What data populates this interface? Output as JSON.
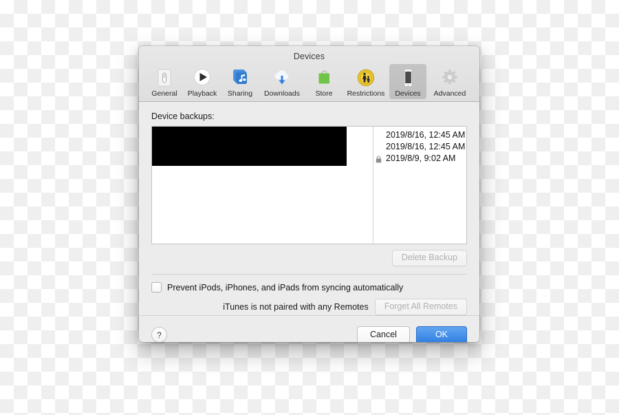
{
  "window": {
    "title": "Devices"
  },
  "toolbar": {
    "tabs": [
      {
        "label": "General",
        "icon": "general-icon",
        "selected": false
      },
      {
        "label": "Playback",
        "icon": "playback-icon",
        "selected": false
      },
      {
        "label": "Sharing",
        "icon": "sharing-icon",
        "selected": false
      },
      {
        "label": "Downloads",
        "icon": "downloads-icon",
        "selected": false
      },
      {
        "label": "Store",
        "icon": "store-icon",
        "selected": false
      },
      {
        "label": "Restrictions",
        "icon": "restrictions-icon",
        "selected": false
      },
      {
        "label": "Devices",
        "icon": "devices-icon",
        "selected": true
      },
      {
        "label": "Advanced",
        "icon": "advanced-icon",
        "selected": false
      }
    ]
  },
  "main": {
    "backups_label": "Device backups:",
    "backup_rows": [
      {
        "name": "",
        "date": "2019/8/16, 12:45 AM",
        "locked": false
      },
      {
        "name": "",
        "date": "2019/8/16, 12:45 AM",
        "locked": false
      },
      {
        "name": "",
        "date": "2019/8/9, 9:02 AM",
        "locked": true
      }
    ],
    "delete_backup_label": "Delete Backup",
    "delete_backup_enabled": false,
    "prevent_sync_label": "Prevent iPods, iPhones, and iPads from syncing automatically",
    "prevent_sync_checked": false,
    "remotes_status": "iTunes is not paired with any Remotes",
    "forget_remotes_label": "Forget All Remotes",
    "forget_remotes_enabled": false
  },
  "footer": {
    "help_label": "?",
    "cancel_label": "Cancel",
    "ok_label": "OK"
  },
  "colors": {
    "accent": "#2f7de1",
    "window_bg": "#ececec",
    "toolbar_bg": "#e2e2e2",
    "redaction": "#000000"
  }
}
